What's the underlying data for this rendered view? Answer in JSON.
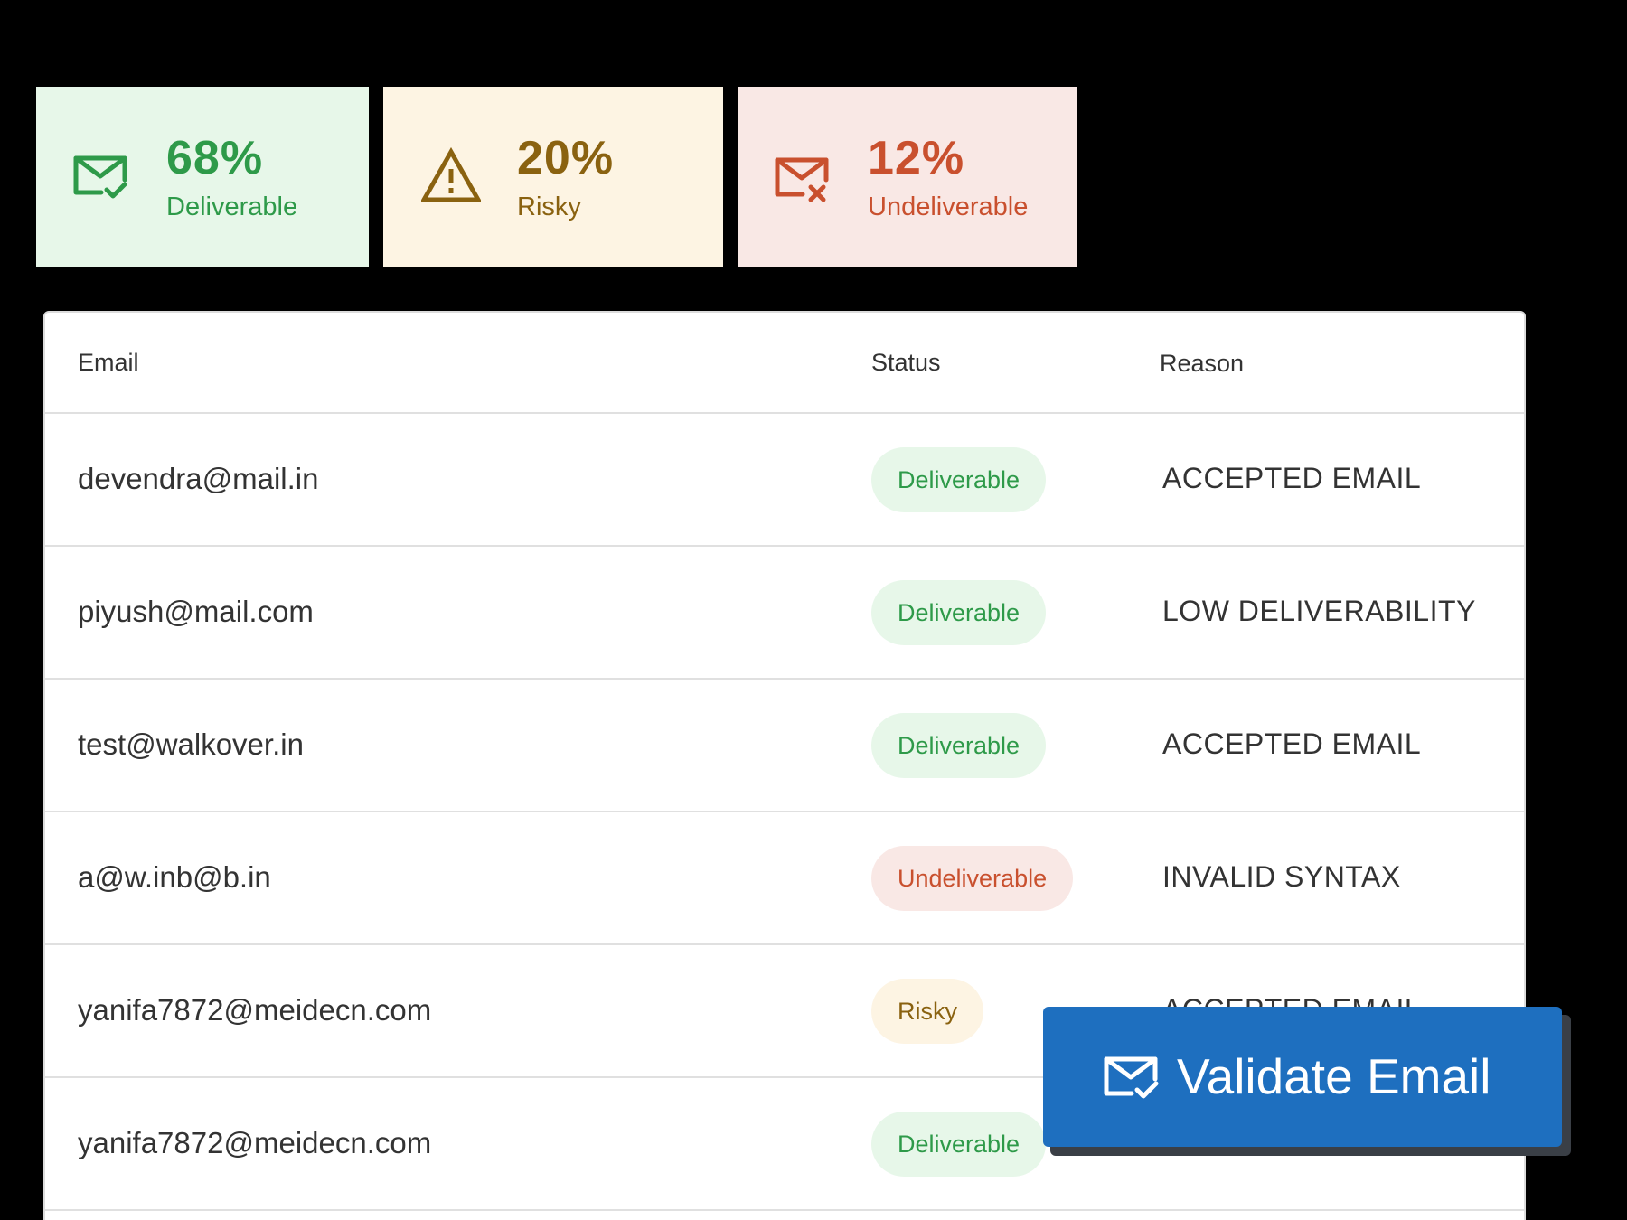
{
  "summary": {
    "deliverable": {
      "percent": "68%",
      "label": "Deliverable",
      "color": "#2e9a49",
      "icon": "mail-check-icon"
    },
    "risky": {
      "percent": "20%",
      "label": "Risky",
      "color": "#8a6210",
      "icon": "warning-triangle-icon"
    },
    "undeliverable": {
      "percent": "12%",
      "label": "Undeliverable",
      "color": "#c9502e",
      "icon": "mail-x-icon"
    }
  },
  "table": {
    "headers": {
      "email": "Email",
      "status": "Status",
      "reason": "Reason"
    },
    "rows": [
      {
        "email": "devendra@mail.in",
        "status": "Deliverable",
        "reason": "ACCEPTED EMAIL"
      },
      {
        "email": "piyush@mail.com",
        "status": "Deliverable",
        "reason": "LOW DELIVERABILITY"
      },
      {
        "email": "test@walkover.in",
        "status": "Deliverable",
        "reason": "ACCEPTED EMAIL"
      },
      {
        "email": "a@w.inb@b.in",
        "status": "Undeliverable",
        "reason": "INVALID SYNTAX"
      },
      {
        "email": "yanifa7872@meidecn.com",
        "status": "Risky",
        "reason": "ACCEPTED EMAIL"
      },
      {
        "email": "yanifa7872@meidecn.com",
        "status": "Deliverable",
        "reason": ""
      }
    ]
  },
  "action": {
    "label": "Validate Email",
    "icon": "mail-check-icon",
    "color": "#1e6fbf"
  }
}
